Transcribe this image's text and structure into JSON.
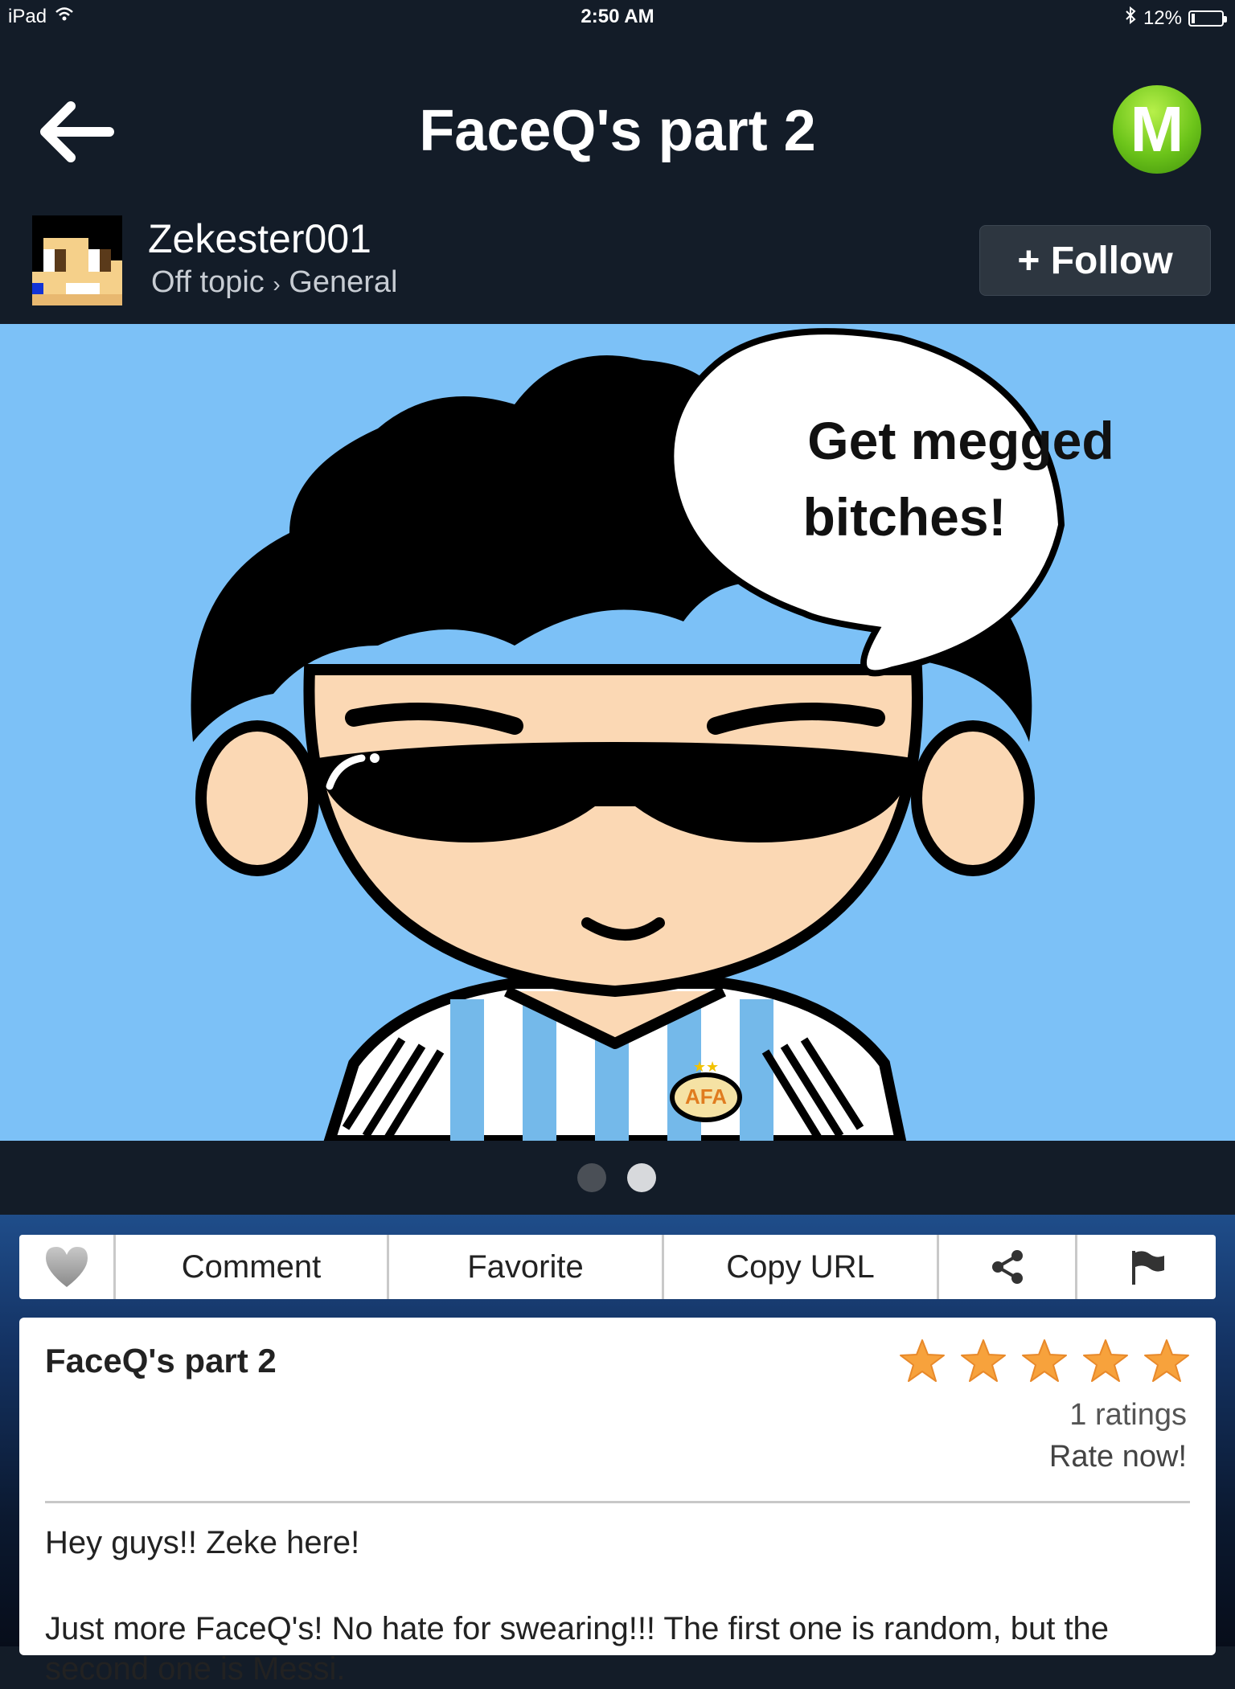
{
  "status_bar": {
    "device": "iPad",
    "time": "2:50 AM",
    "battery_text": "12%",
    "battery_level": 0.12
  },
  "nav": {
    "title": "FaceQ's part 2",
    "logo_letter": "M"
  },
  "post_header": {
    "username": "Zekester001",
    "category": "Off topic",
    "subcategory": "General",
    "crumb_separator": "›",
    "follow_label": "+ Follow"
  },
  "image": {
    "speech_line_1": "Get megged",
    "speech_line_2": "bitches!",
    "page_count": 2,
    "current_page": 2
  },
  "actions": {
    "comment_label": "Comment",
    "favorite_label": "Favorite",
    "copy_url_label": "Copy URL"
  },
  "post": {
    "title": "FaceQ's part 2",
    "rating_stars": 5,
    "ratings_text": "1 ratings",
    "rate_now_label": "Rate now!",
    "body_line_1": "Hey guys!! Zeke here!",
    "body_line_2": "Just more FaceQ's! No hate for swearing!!! The first one is random, but the second one is Messi."
  },
  "colors": {
    "background": "#131c28",
    "image_bg": "#7cc1f7",
    "star": "#f7a23c",
    "logo_green": "#6cc41a"
  }
}
